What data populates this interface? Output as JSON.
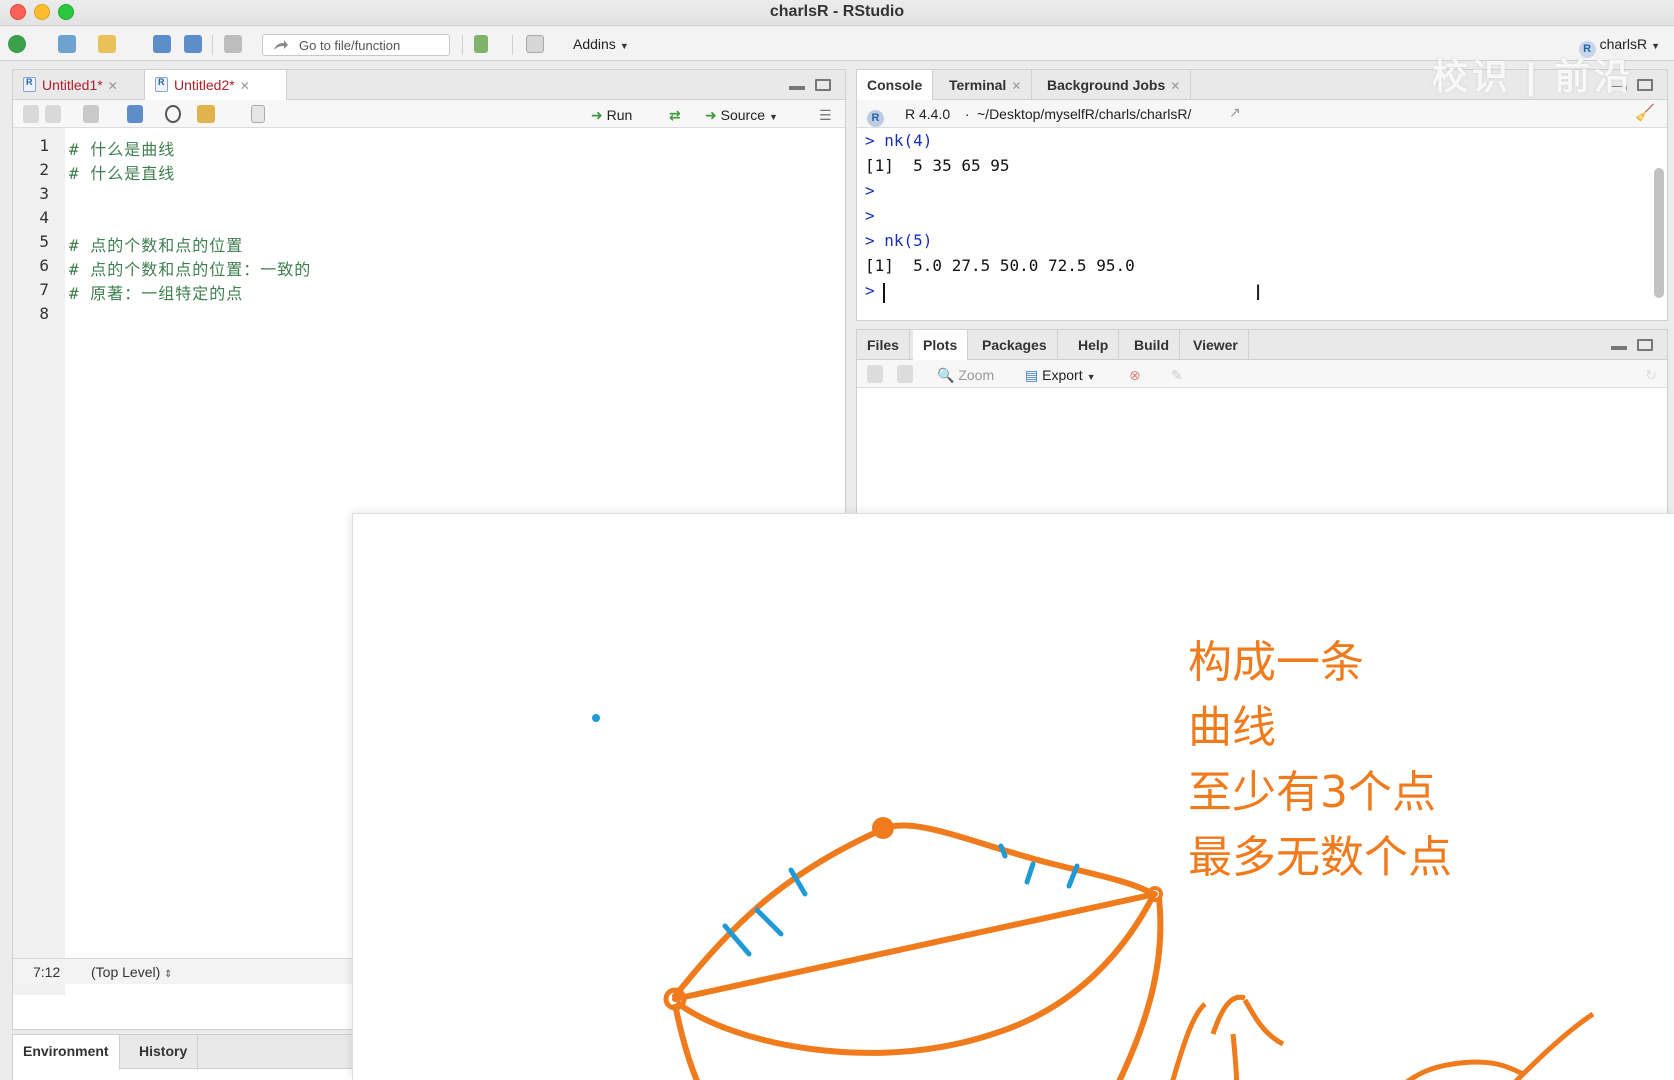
{
  "window": {
    "title": "charlsR - RStudio"
  },
  "toolbar": {
    "goto_placeholder": "Go to file/function",
    "addins_label": "Addins",
    "project_label": "charlsR",
    "icons": [
      "new-file-icon",
      "new-project-icon",
      "open-folder-icon",
      "save-icon",
      "save-all-icon",
      "print-icon",
      "vcs-icon",
      "grid-layout-icon"
    ]
  },
  "editor": {
    "tabs": [
      {
        "label": "Untitled1*"
      },
      {
        "label": "Untitled2*"
      }
    ],
    "run_label": "Run",
    "source_label": "Source",
    "lines": [
      {
        "num": "1",
        "text": "# 什么是曲线"
      },
      {
        "num": "2",
        "text": "# 什么是直线"
      },
      {
        "num": "3",
        "text": ""
      },
      {
        "num": "4",
        "text": ""
      },
      {
        "num": "5",
        "text": "# 点的个数和点的位置"
      },
      {
        "num": "6",
        "text": "# 点的个数和点的位置：一致的"
      },
      {
        "num": "7",
        "text": "# 原著：一组特定的点"
      },
      {
        "num": "8",
        "text": ""
      }
    ],
    "status_position": "7:12",
    "status_scope": "(Top Level)"
  },
  "env_pane": {
    "tabs": [
      {
        "label": "Environment"
      },
      {
        "label": "History"
      }
    ]
  },
  "console": {
    "tabs": [
      {
        "label": "Console"
      },
      {
        "label": "Terminal"
      },
      {
        "label": "Background Jobs"
      }
    ],
    "r_version": "R 4.4.0",
    "path": "~/Desktop/myselfR/charls/charlsR/",
    "lines": [
      {
        "kind": "in",
        "text": "> nk(4)"
      },
      {
        "kind": "out",
        "text": "[1]  5 35 65 95"
      },
      {
        "kind": "in",
        "text": ">"
      },
      {
        "kind": "in",
        "text": ">"
      },
      {
        "kind": "in",
        "text": "> nk(5)"
      },
      {
        "kind": "out",
        "text": "[1]  5.0 27.5 50.0 72.5 95.0"
      },
      {
        "kind": "in",
        "text": ">"
      }
    ]
  },
  "files_pane": {
    "tabs": [
      {
        "label": "Files"
      },
      {
        "label": "Plots"
      },
      {
        "label": "Packages"
      },
      {
        "label": "Help"
      },
      {
        "label": "Build"
      },
      {
        "label": "Viewer"
      }
    ],
    "zoom_label": "Zoom",
    "export_label": "Export"
  },
  "whiteboard": {
    "notes": [
      "构成一条",
      "曲线",
      "至少有3个点",
      "最多无数个点"
    ],
    "colors": {
      "ink_orange": "#f07b1d",
      "ink_blue": "#1e9ad6"
    }
  },
  "watermark": "校识 | 前沿"
}
